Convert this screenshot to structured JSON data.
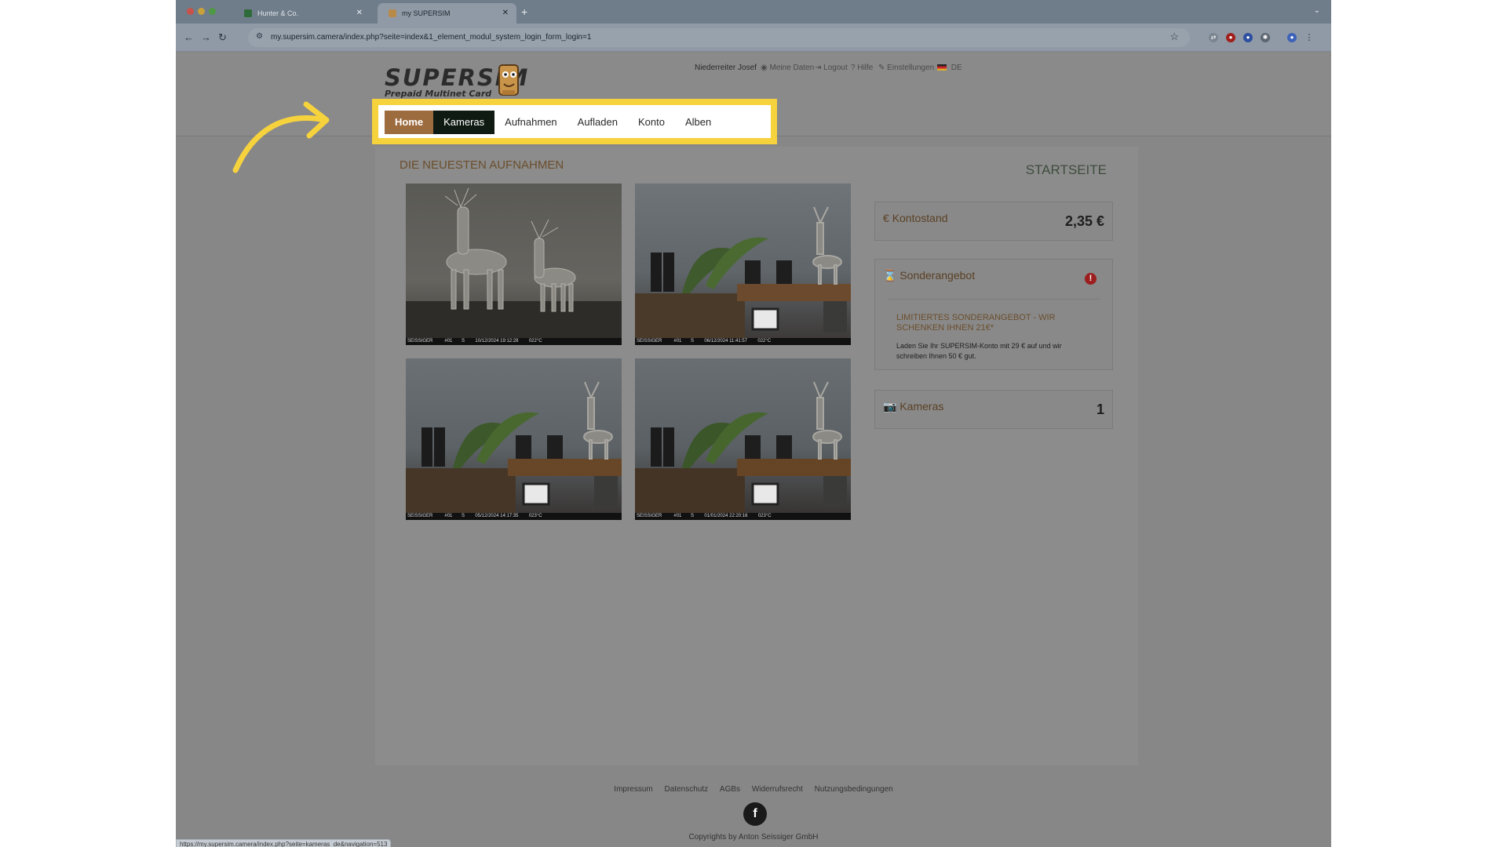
{
  "browser": {
    "tabs": [
      {
        "label": "Hunter & Co.",
        "active": false
      },
      {
        "label": "my SUPERSIM",
        "active": true
      }
    ],
    "url": "my.supersim.camera/index.php?seite=index&1_element_modul_system_login_form_login=1",
    "status_url": "https://my.supersim.camera/index.php?seite=kameras_de&navigation=513"
  },
  "header": {
    "logo_main": "SUPERSIM",
    "logo_sub": "Prepaid Multinet Card",
    "user_name": "Niederreiter Josef",
    "links": [
      "Meine Daten",
      "Logout",
      "Hilfe",
      "Einstellungen"
    ],
    "language": "DE"
  },
  "menu": {
    "items": [
      "Home",
      "Kameras",
      "Aufnahmen",
      "Aufladen",
      "Konto",
      "Alben"
    ],
    "active": "Home",
    "hover": "Kameras"
  },
  "main": {
    "section_title": "DIE NEUESTEN AUFNAHMEN",
    "page_title": "STARTSEITE",
    "photos": [
      {
        "brand": "SEISSIGER",
        "cam": "#01",
        "dir": "S",
        "datetime": "10/12/2024 19:12:28",
        "temp": "022°C"
      },
      {
        "brand": "SEISSIGER",
        "cam": "#01",
        "dir": "S",
        "datetime": "06/12/2024 11:41:57",
        "temp": "022°C"
      },
      {
        "brand": "SEISSIGER",
        "cam": "#01",
        "dir": "S",
        "datetime": "05/12/2024 14:17:35",
        "temp": "023°C"
      },
      {
        "brand": "SEISSIGER",
        "cam": "#01",
        "dir": "S",
        "datetime": "01/01/2024 22:20:16",
        "temp": "023°C"
      }
    ]
  },
  "sidebar": {
    "balance_label": "Kontostand",
    "balance_value": "2,35 €",
    "offer_label": "Sonderangebot",
    "offer_title": "LIMITIERTES SONDERANGEBOT - WIR SCHENKEN IHNEN 21€*",
    "offer_text": "Laden Sie Ihr SUPERSIM-Konto mit 29 € auf und wir schreiben Ihnen 50 € gut.",
    "cameras_label": "Kameras",
    "cameras_value": "1"
  },
  "footer": {
    "links": [
      "Impressum",
      "Datenschutz",
      "AGBs",
      "Widerrufsrecht",
      "Nutzungsbedingungen"
    ],
    "copyright": "Copyrights by Anton Seissiger GmbH"
  },
  "colors": {
    "highlight": "#f6d23d",
    "menu_active": "#9c6b3e",
    "menu_hover": "#0e1a12",
    "accent_text": "#6b4e2c"
  }
}
